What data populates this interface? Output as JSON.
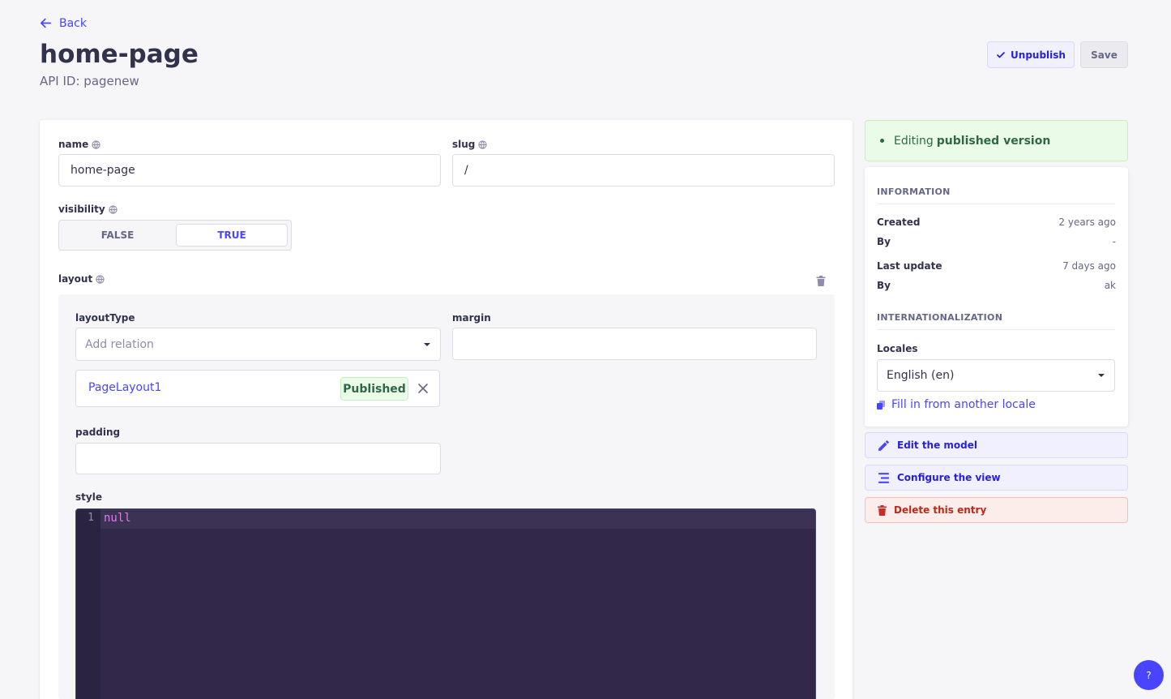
{
  "header": {
    "back_label": "Back",
    "title": "home-page",
    "api_id": "API ID: pagenew",
    "unpublish_label": "Unpublish",
    "save_label": "Save"
  },
  "form": {
    "name": {
      "label": "name",
      "value": "home-page"
    },
    "slug": {
      "label": "slug",
      "value": "/"
    },
    "visibility": {
      "label": "visibility",
      "options": [
        "FALSE",
        "TRUE"
      ],
      "selected": "TRUE"
    },
    "layout": {
      "label": "layout",
      "layoutType": {
        "label": "layoutType",
        "placeholder": "Add relation"
      },
      "margin": {
        "label": "margin",
        "value": ""
      },
      "relation": {
        "name": "PageLayout1",
        "status": "Published"
      },
      "padding": {
        "label": "padding",
        "value": ""
      },
      "style": {
        "label": "style",
        "line_number": "1",
        "code": "null"
      }
    }
  },
  "sidebar": {
    "status_prefix": "Editing",
    "status_bold": "published version",
    "information": {
      "title": "INFORMATION",
      "created_label": "Created",
      "created_value": "2 years ago",
      "created_by_label": "By",
      "created_by_value": "-",
      "updated_label": "Last update",
      "updated_value": "7 days ago",
      "updated_by_label": "By",
      "updated_by_value": "ak"
    },
    "i18n": {
      "title": "INTERNATIONALIZATION",
      "locales_label": "Locales",
      "locale_value": "English (en)",
      "fill_link": "Fill in from another locale"
    },
    "actions": {
      "edit_model": "Edit the model",
      "configure_view": "Configure the view",
      "delete_entry": "Delete this entry"
    }
  },
  "help_label": "?",
  "colors": {
    "primary": "#4945ff",
    "success_bg": "#eafbe7",
    "success_text": "#2f6846",
    "danger_bg": "#fcecea",
    "danger_text": "#b72b1a",
    "editor_bg": "#32294a"
  }
}
